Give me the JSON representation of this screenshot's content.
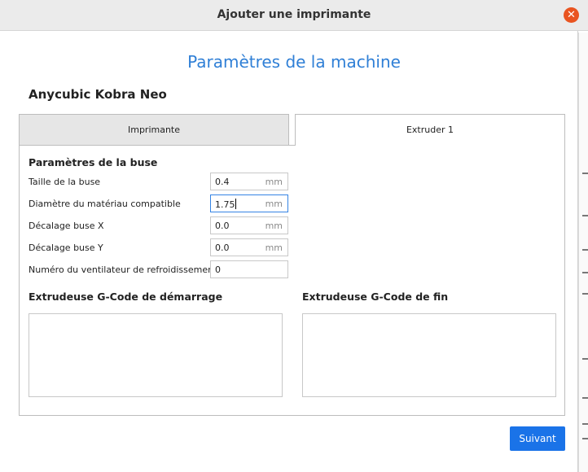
{
  "window": {
    "title": "Ajouter une imprimante",
    "close_icon": "close-icon"
  },
  "page": {
    "heading": "Paramètres de la machine",
    "printer_name": "Anycubic Kobra Neo"
  },
  "tabs": [
    {
      "label": "Imprimante",
      "selected": false
    },
    {
      "label": "Extruder 1",
      "selected": true
    }
  ],
  "nozzle": {
    "section_title": "Paramètres de la buse",
    "fields": [
      {
        "label": "Taille de la buse",
        "value": "0.4",
        "unit": "mm"
      },
      {
        "label": "Diamètre du matériau compatible",
        "value": "1.75",
        "unit": "mm"
      },
      {
        "label": "Décalage buse X",
        "value": "0.0",
        "unit": "mm"
      },
      {
        "label": "Décalage buse Y",
        "value": "0.0",
        "unit": "mm"
      },
      {
        "label": "Numéro du ventilateur de refroidissement",
        "value": "0",
        "unit": ""
      }
    ]
  },
  "gcode": {
    "start_title": "Extrudeuse G-Code de démarrage",
    "start_value": "",
    "end_title": "Extrudeuse G-Code de fin",
    "end_value": ""
  },
  "footer": {
    "next_label": "Suivant"
  },
  "colors": {
    "accent": "#1a73e8",
    "heading": "#2f7fd6",
    "close": "#e95420"
  }
}
